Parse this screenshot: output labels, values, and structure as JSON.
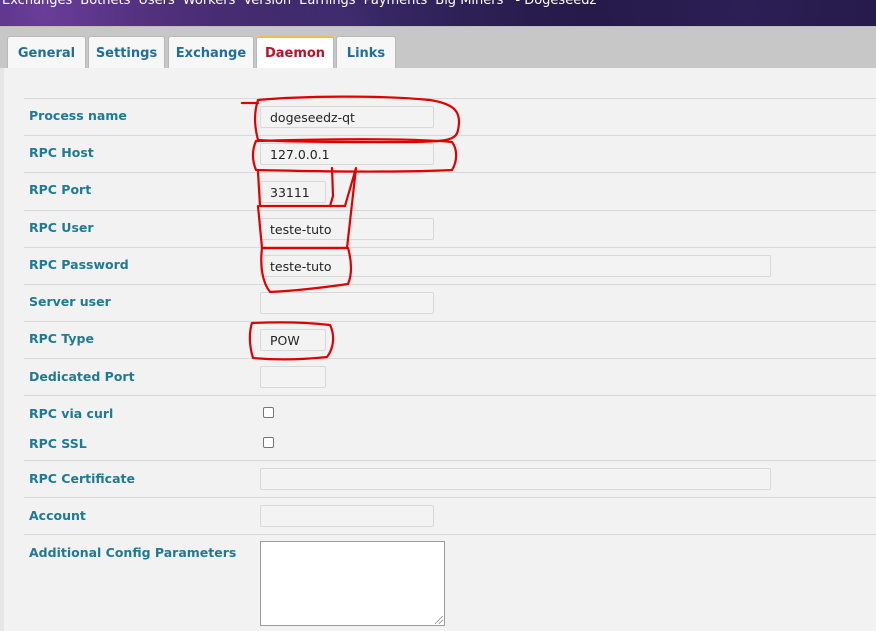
{
  "topnav": {
    "items": [
      "Exchanges",
      "Botnets",
      "Users",
      "Workers",
      "Version",
      "Earnings",
      "Payments",
      "Big Miners"
    ],
    "site_title": "- Dogeseedz"
  },
  "tabs": [
    {
      "label": "General",
      "active": false
    },
    {
      "label": "Settings",
      "active": false
    },
    {
      "label": "Exchange",
      "active": false
    },
    {
      "label": "Daemon",
      "active": true
    },
    {
      "label": "Links",
      "active": false
    }
  ],
  "form": {
    "process_name": {
      "label": "Process name",
      "value": "dogeseedz-qt"
    },
    "rpc_host": {
      "label": "RPC Host",
      "value": "127.0.0.1"
    },
    "rpc_port": {
      "label": "RPC Port",
      "value": "33111"
    },
    "rpc_user": {
      "label": "RPC User",
      "value": "teste-tuto"
    },
    "rpc_password": {
      "label": "RPC Password",
      "value": "teste-tuto"
    },
    "server_user": {
      "label": "Server user",
      "value": ""
    },
    "rpc_type": {
      "label": "RPC Type",
      "value": "POW"
    },
    "dedicated_port": {
      "label": "Dedicated Port",
      "value": ""
    },
    "rpc_via_curl": {
      "label": "RPC via curl",
      "checked": false
    },
    "rpc_ssl": {
      "label": "RPC SSL",
      "checked": false
    },
    "rpc_certificate": {
      "label": "RPC Certificate",
      "value": ""
    },
    "account": {
      "label": "Account",
      "value": ""
    },
    "additional_config": {
      "label": "Additional Config Parameters",
      "value": ""
    }
  },
  "colors": {
    "label": "#1f7a93",
    "tab_text": "#1f6f99",
    "active_tab_text": "#b5142b",
    "annotation": "#e10000"
  }
}
